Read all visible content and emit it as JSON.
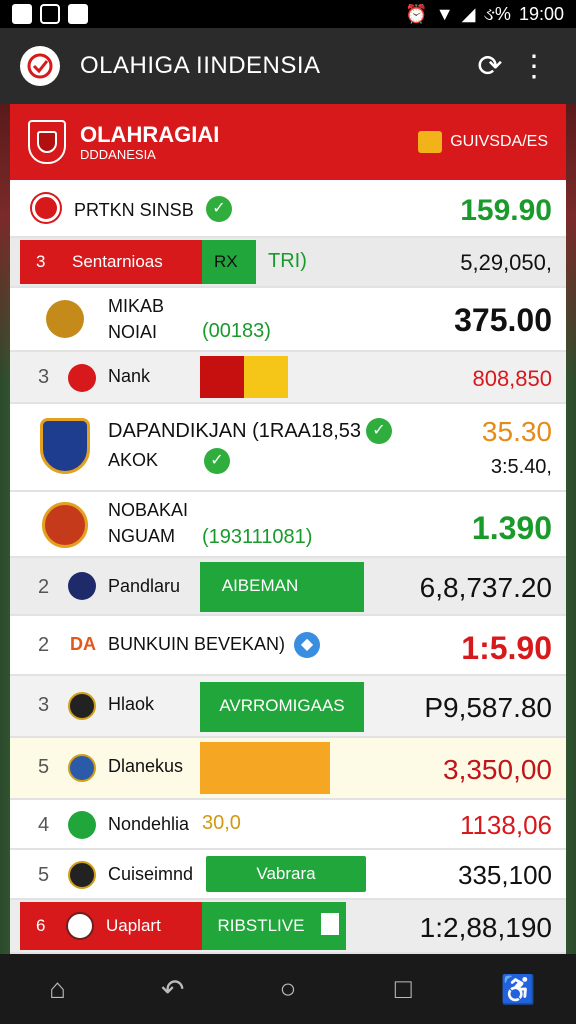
{
  "status": {
    "battery_pct": "ઙ%",
    "time": "19:00"
  },
  "appbar": {
    "title": "OLAHIGA IINDENSIA",
    "refresh_icon": "refresh-icon",
    "more_icon": "more-vert-icon"
  },
  "header": {
    "title": "OLAHRAGIAI",
    "subtitle": "DDDANESIA",
    "link": "GUIVSDA/ES"
  },
  "rows": {
    "r0": {
      "name": "PRTKN SINSB",
      "value": "159.90"
    },
    "r1": {
      "rank": "3",
      "name": "Sentarnioas",
      "badge": "RX",
      "tag": "TRI)",
      "value": "5,29,050,"
    },
    "r2": {
      "name": "MIKAB",
      "sub": "NOIAI",
      "tag": "(00183)",
      "value": "375.00"
    },
    "r3": {
      "rank": "3",
      "name": "Nank",
      "value": "808,850"
    },
    "r4": {
      "name": "DAPANDIKJAN (1RAA18,53",
      "sub": "AKOK",
      "value": "35.30",
      "value2": "3:5.40,"
    },
    "r5": {
      "name": "NOBAKAI",
      "sub": "NGUAM",
      "tag": "(193111081)",
      "value": "1.390"
    },
    "r6": {
      "rank": "2",
      "name": "Pandlaru",
      "bar_label": "AIBEMAN",
      "value": "6,8,737.20"
    },
    "r7": {
      "rank": "2",
      "abbr": "DA",
      "name": "BUNKUIN BEVEKAN)",
      "value": "1:5.90"
    },
    "r8": {
      "rank": "3",
      "name": "Hlaok",
      "bar_label": "AVRROMIGAAS",
      "value": "P9,587.80"
    },
    "r9": {
      "rank": "5",
      "name": "Dlanekus",
      "value": "3,350,00"
    },
    "r10": {
      "rank": "4",
      "name": "Nondehlia",
      "tag": "30,0",
      "value": "1138,06"
    },
    "r11": {
      "rank": "5",
      "name": "Cuiseimnd",
      "bar_label": "Vabrara",
      "value": "335,100"
    },
    "r12": {
      "rank": "6",
      "name": "Uaplart",
      "bar_label": "RIBSTLIVE",
      "value": "1:2,88,190"
    }
  },
  "colors": {
    "red": "#d7191c",
    "green": "#1a9a2a",
    "yellow": "#f2b21a",
    "orange": "#f5a623"
  }
}
